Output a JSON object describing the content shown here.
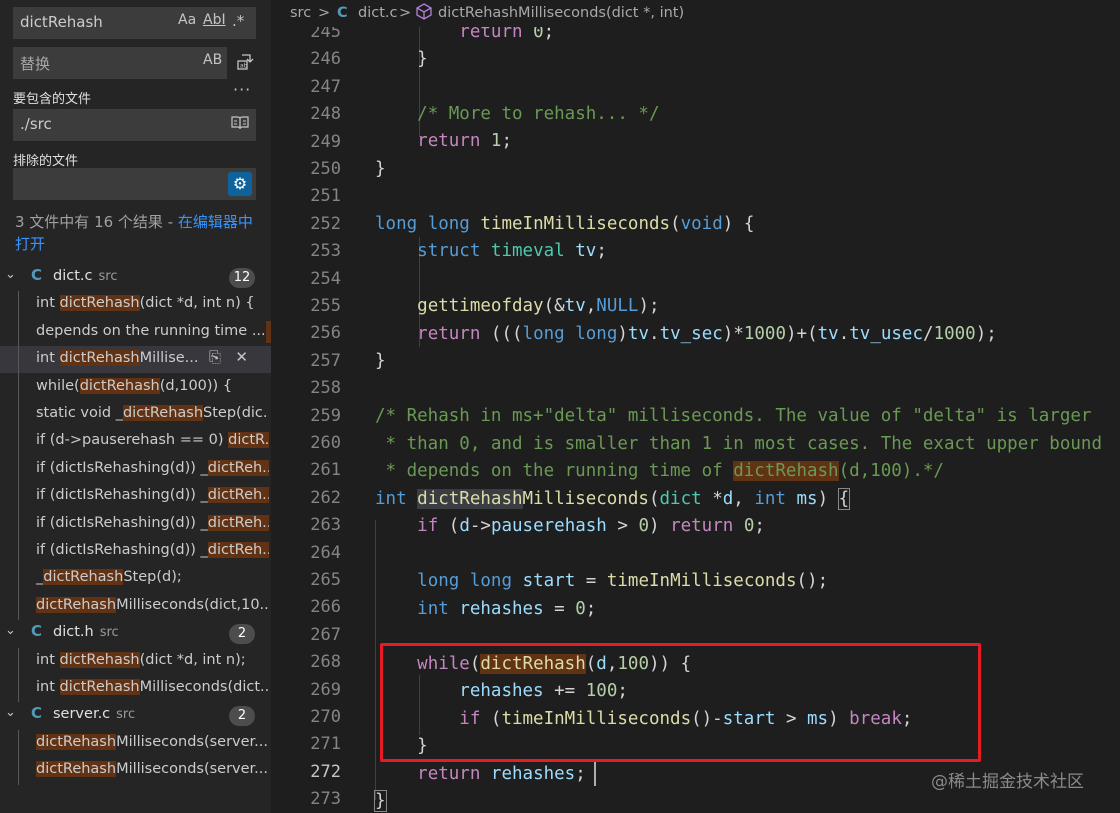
{
  "search": {
    "query": "dictRehash",
    "match_case": "Aa",
    "whole_word": "AbI",
    "regex": ".*",
    "replace_placeholder": "替换",
    "preserve_case": "AB",
    "more": "···",
    "include_label": "要包含的文件",
    "include_value": "./src",
    "exclude_label": "排除的文件",
    "exclude_value": ""
  },
  "summary": {
    "text": "3 文件中有 16 个结果 - ",
    "link": "在编辑器中打开"
  },
  "files": [
    {
      "name": "dict.c",
      "dir": "src",
      "count": "12",
      "matches": [
        {
          "pre": "int ",
          "hit": "dictRehash",
          "post": "(dict *d, int n) {"
        },
        {
          "pre": "depends on the running time ...",
          "hit": "",
          "post": ""
        },
        {
          "pre": "int ",
          "hit": "dictRehash",
          "post": "Millise..."
        },
        {
          "pre": "while(",
          "hit": "dictRehash",
          "post": "(d,100)) {"
        },
        {
          "pre": "static void _",
          "hit": "dictRehash",
          "post": "Step(dic..."
        },
        {
          "pre": "if (d->pauserehash == 0) ",
          "hit": "dictR...",
          "post": ""
        },
        {
          "pre": "if (dictIsRehashing(d)) _",
          "hit": "dictReh...",
          "post": ""
        },
        {
          "pre": "if (dictIsRehashing(d)) _",
          "hit": "dictReh...",
          "post": ""
        },
        {
          "pre": "if (dictIsRehashing(d)) _",
          "hit": "dictReh...",
          "post": ""
        },
        {
          "pre": "if (dictIsRehashing(d)) _",
          "hit": "dictReh...",
          "post": ""
        },
        {
          "pre": "_",
          "hit": "dictRehash",
          "post": "Step(d);"
        },
        {
          "pre": "",
          "hit": "dictRehash",
          "post": "Milliseconds(dict,10..."
        }
      ]
    },
    {
      "name": "dict.h",
      "dir": "src",
      "count": "2",
      "matches": [
        {
          "pre": "int ",
          "hit": "dictRehash",
          "post": "(dict *d, int n);"
        },
        {
          "pre": "int ",
          "hit": "dictRehash",
          "post": "Milliseconds(dict..."
        }
      ]
    },
    {
      "name": "server.c",
      "dir": "src",
      "count": "2",
      "matches": [
        {
          "pre": "",
          "hit": "dictRehash",
          "post": "Milliseconds(server...."
        },
        {
          "pre": "",
          "hit": "dictRehash",
          "post": "Milliseconds(server...."
        }
      ]
    }
  ],
  "breadcrumb": {
    "folder": "src",
    "sep": ">",
    "file_icon": "C",
    "file": "dict.c",
    "symbol": "dictRehashMilliseconds(dict *, int)"
  },
  "editor": {
    "lines": [
      "245",
      "246",
      "247",
      "248",
      "249",
      "250",
      "251",
      "252",
      "253",
      "254",
      "255",
      "256",
      "257",
      "258",
      "259",
      "260",
      "261",
      "262",
      "263",
      "264",
      "265",
      "266",
      "267",
      "268",
      "269",
      "270",
      "271",
      "272",
      "273"
    ],
    "current_line": "272"
  },
  "watermark": "@稀土掘金技术社区",
  "icons": {
    "file": "c-file-icon",
    "replace_all": "replace-all-icon",
    "book": "book-icon",
    "gear": "gear-icon",
    "collapse": "chevron-down-icon",
    "dismiss": "close-icon"
  },
  "colors": {
    "match_highlight": "#613214",
    "red_box": "#e51c23",
    "link": "#3794ff"
  }
}
